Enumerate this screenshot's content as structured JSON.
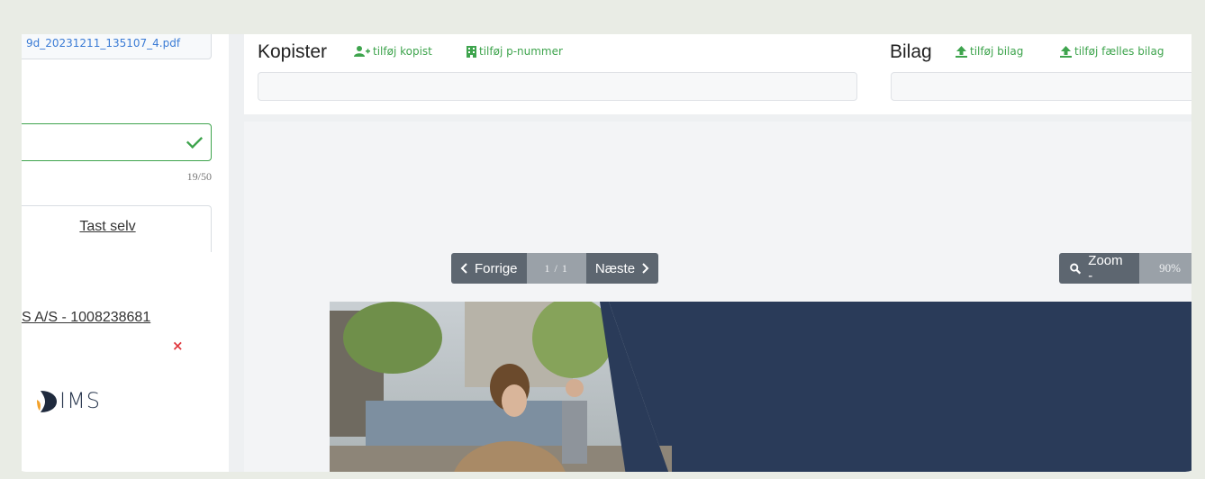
{
  "left_panel": {
    "file_name": "9d_20231211_135107_4.pdf",
    "counter": "19/50",
    "tast_selv": "Tast selv",
    "company": "S A/S - 1008238681",
    "remove": "×",
    "logo_text": "IMS"
  },
  "kopister": {
    "title": "Kopister",
    "add_copyist": "tilføj kopist",
    "add_p_number": "tilføj p-nummer"
  },
  "bilag": {
    "title": "Bilag",
    "add_attachment": "tilføj bilag",
    "add_shared_attachment": "tilføj fælles bilag"
  },
  "viewer": {
    "prev": "Forrige",
    "page": "1 / 1",
    "next": "Næste",
    "zoom_out": "Zoom -",
    "zoom_level": "90%"
  },
  "colors": {
    "accent_green": "#3ea44d",
    "link_blue": "#3a7bd5",
    "doc_navy": "#2a3b59",
    "error_red": "#e0383e"
  }
}
